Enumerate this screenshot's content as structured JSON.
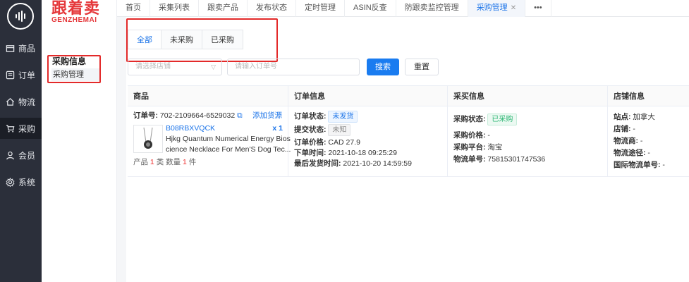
{
  "rail": {
    "items": [
      {
        "label": "商品",
        "icon": "box-icon"
      },
      {
        "label": "订单",
        "icon": "list-icon"
      },
      {
        "label": "物流",
        "icon": "home-icon"
      },
      {
        "label": "采购",
        "icon": "cart-icon"
      },
      {
        "label": "会员",
        "icon": "user-icon"
      },
      {
        "label": "系统",
        "icon": "gear-icon"
      }
    ],
    "active": "采购"
  },
  "brand": {
    "cn": "跟着卖",
    "en": "GENZHEMAI"
  },
  "side": {
    "title": "采购信息",
    "item": "采购管理"
  },
  "tabs": [
    "首页",
    "采集列表",
    "跟卖产品",
    "发布状态",
    "定时管理",
    "ASIN反查",
    "防跟卖监控管理",
    "采购管理",
    "•••"
  ],
  "active_tab": "采购管理",
  "subtabs": [
    "全部",
    "未采购",
    "已采购"
  ],
  "filters": {
    "store_placeholder": "请选择店铺",
    "order_placeholder": "请输入订单号",
    "search_label": "搜索",
    "reset_label": "重置"
  },
  "columns": [
    "商品",
    "订单信息",
    "采买信息",
    "店铺信息"
  ],
  "order": {
    "order_no_label": "订单号:",
    "order_no": "702-2109664-6529032",
    "add_source": "添加货源",
    "asin": "B08RBXVQCK",
    "qty": "x 1",
    "title_line1": "Hjkg Quantum Numerical Energy Bios",
    "title_line2": "cience Necklace For Men'S Dog Tec...",
    "summary_prefix": "产品",
    "summary_kinds": "1",
    "summary_kinds_unit": "类",
    "summary_qty_label": "数量",
    "summary_qty": "1",
    "summary_qty_unit": "件",
    "order_status_label": "订单状态:",
    "order_status": "未发货",
    "submit_status_label": "提交状态:",
    "submit_status": "未知",
    "price_label": "订单价格:",
    "price": "CAD 27.9",
    "order_time_label": "下单时间:",
    "order_time": "2021-10-18 09:25:29",
    "ship_time_label": "最后发货时间:",
    "ship_time": "2021-10-20 14:59:59",
    "purchase_status_label": "采购状态:",
    "purchase_status": "已采购",
    "purchase_price_label": "采购价格:",
    "purchase_price": "-",
    "platform_label": "采购平台:",
    "platform": "淘宝",
    "tracking_label": "物流单号:",
    "tracking": "75815301747536",
    "site_label": "站点:",
    "site": "加拿大",
    "store_label": "店铺:",
    "store": "-",
    "carrier_label": "物流商:",
    "carrier": "-",
    "route_label": "物流途径:",
    "route": "-",
    "intl_tracking_label": "国际物流单号:",
    "intl_tracking": "-"
  }
}
